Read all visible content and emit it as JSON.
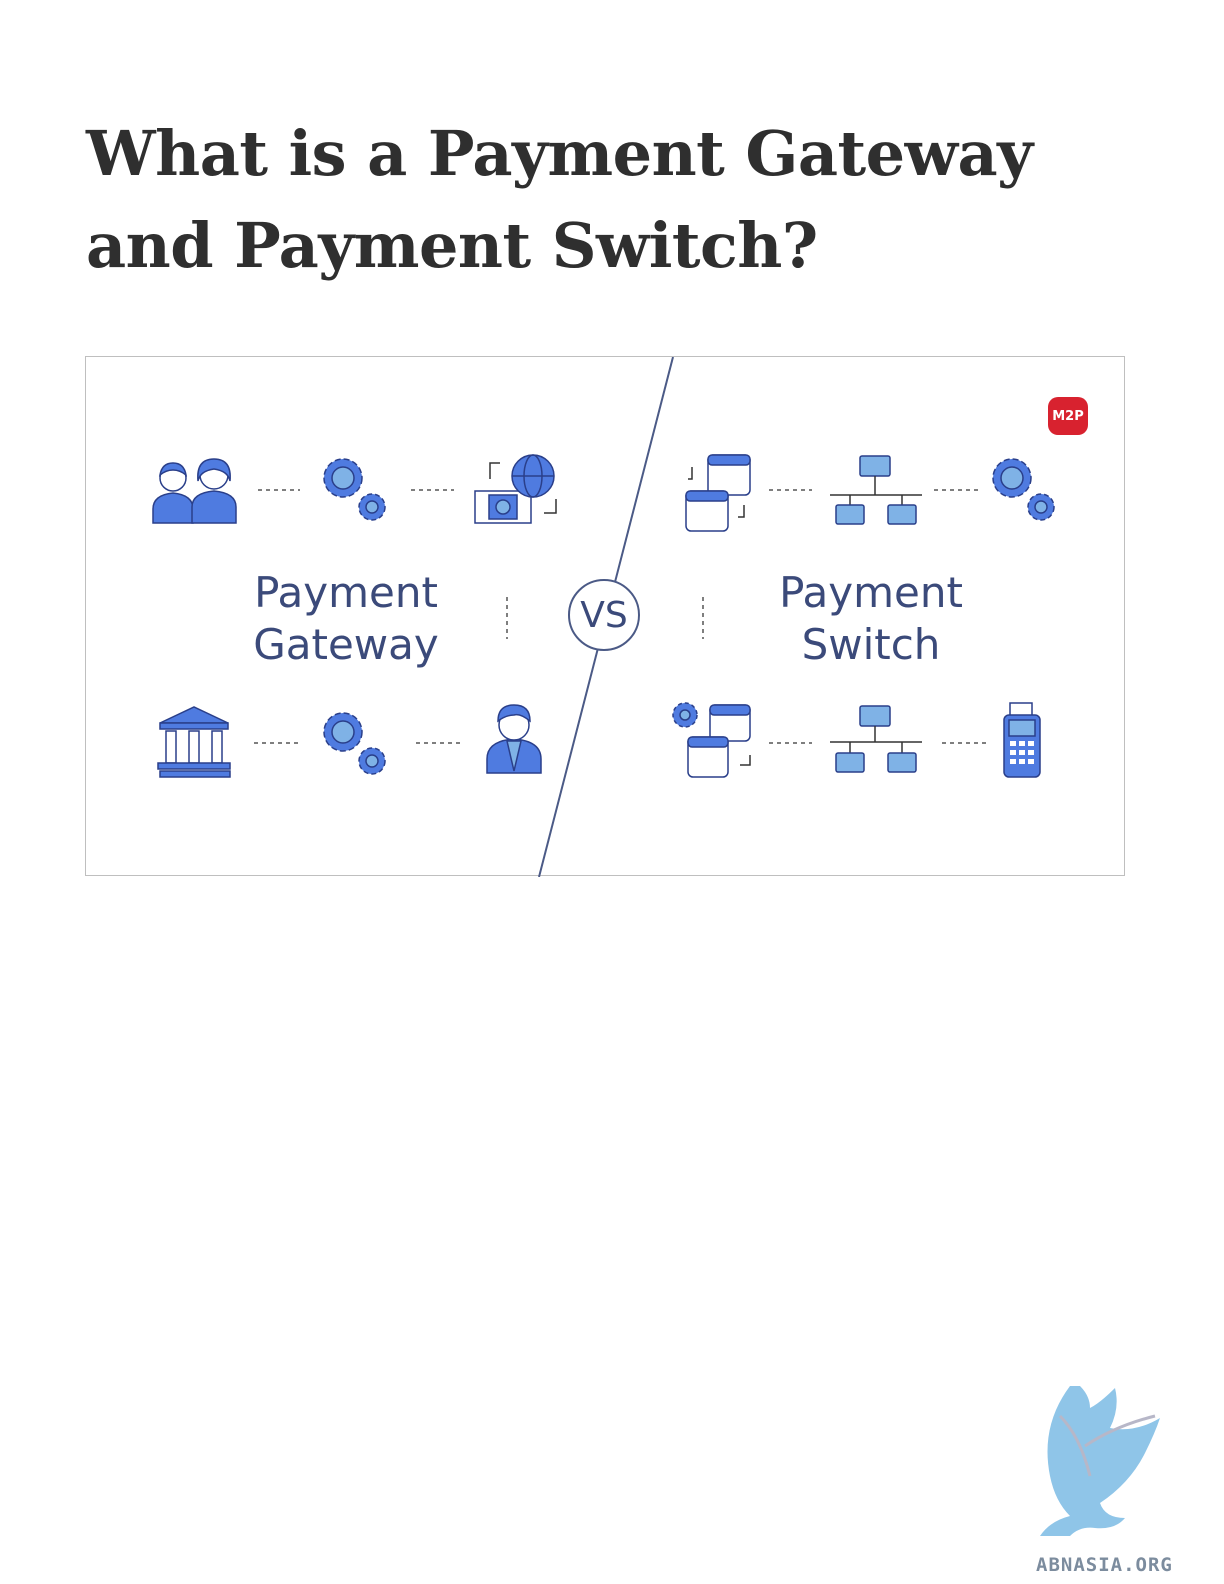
{
  "document": {
    "title": "What is a Payment Gateway and Payment Switch?"
  },
  "figure": {
    "left_heading": [
      "Payment",
      "Gateway"
    ],
    "right_heading": [
      "Payment",
      "Switch"
    ],
    "vs_label": "VS",
    "brand_badge": "M2P",
    "icons": {
      "left_top": [
        "users-icon",
        "gears-icon",
        "globe-money-icon"
      ],
      "left_bottom": [
        "bank-icon",
        "gears-icon",
        "businessman-icon"
      ],
      "right_top": [
        "windows-exchange-icon",
        "network-icon",
        "gears-icon"
      ],
      "right_bottom": [
        "gear-windows-icon",
        "network-icon",
        "pos-terminal-icon"
      ]
    },
    "colors": {
      "icon_blue": "#4f7be0",
      "icon_light": "#7fb2e6",
      "text": "#3b4a7a",
      "badge": "#d8222f"
    }
  },
  "watermark": {
    "text": "ABNASIA.ORG"
  }
}
